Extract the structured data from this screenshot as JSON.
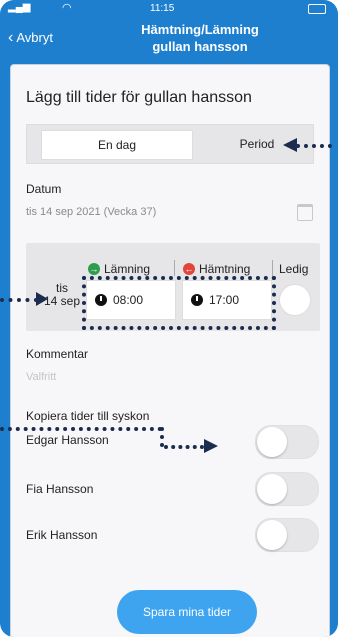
{
  "status_bar": {
    "time": "11:15"
  },
  "header": {
    "back_label": "Avbryt",
    "title_line1": "Hämtning/Lämning",
    "title_line2": "gullan hansson"
  },
  "form": {
    "title": "Lägg till tider för gullan hansson",
    "segments": [
      {
        "label": "En dag",
        "selected": true
      },
      {
        "label": "Period",
        "selected": false
      }
    ],
    "date_label": "Datum",
    "date_value": "tis 14 sep 2021 (Vecka 37)",
    "times": {
      "drop_label": "Lämning",
      "pickup_label": "Hämtning",
      "free_label": "Ledig",
      "day_weekday": "tis",
      "day_date": "14 sep",
      "drop_time": "08:00",
      "pickup_time": "17:00"
    },
    "comment_label": "Kommentar",
    "comment_placeholder": "Valfritt",
    "copy_label": "Kopiera tider till syskon",
    "siblings": [
      {
        "name": "Edgar Hansson",
        "on": false
      },
      {
        "name": "Fia Hansson",
        "on": false
      },
      {
        "name": "Erik Hansson",
        "on": false
      }
    ],
    "save_label": "Spara mina tider"
  },
  "colors": {
    "accent": "#1f7fcf",
    "save_button": "#3fa4f0",
    "drop_icon": "#2e9e4e",
    "pickup_icon": "#e0463c",
    "annotation": "#1b2c4f"
  }
}
